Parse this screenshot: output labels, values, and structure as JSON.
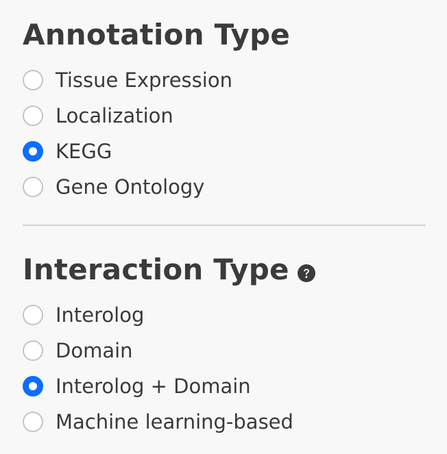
{
  "annotation": {
    "title": "Annotation Type",
    "options": [
      {
        "label": "Tissue Expression",
        "checked": false
      },
      {
        "label": "Localization",
        "checked": false
      },
      {
        "label": "KEGG",
        "checked": true
      },
      {
        "label": "Gene Ontology",
        "checked": false
      }
    ]
  },
  "interaction": {
    "title": "Interaction Type",
    "help_icon": "question-circle-icon",
    "options": [
      {
        "label": "Interolog",
        "checked": false
      },
      {
        "label": "Domain",
        "checked": false
      },
      {
        "label": "Interolog + Domain",
        "checked": true
      },
      {
        "label": "Machine learning-based",
        "checked": false
      }
    ]
  },
  "colors": {
    "accent": "#0d6efd",
    "text": "#3a3a3a",
    "background": "#f8f8f8",
    "divider": "#d2d2d2",
    "radio_border": "#c4c4c4"
  }
}
